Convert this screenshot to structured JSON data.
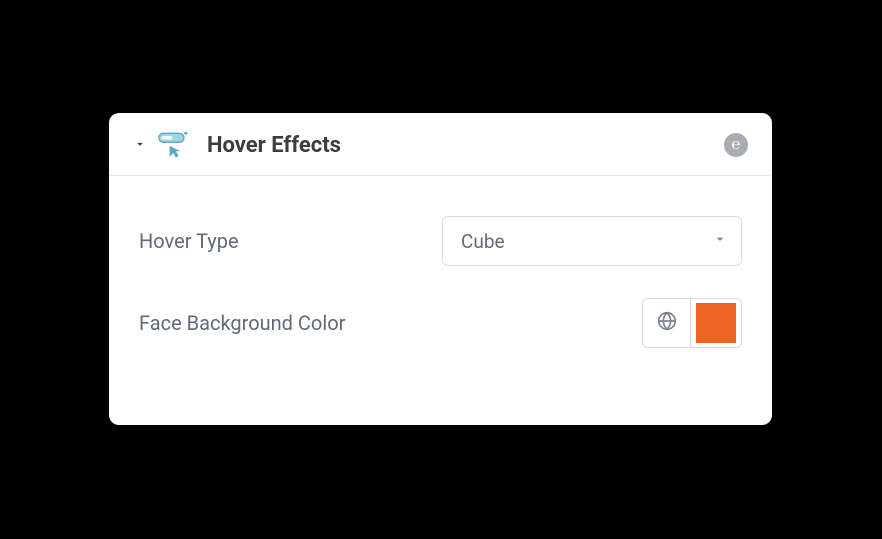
{
  "panel": {
    "title": "Hover Effects",
    "badge_glyph": "℮"
  },
  "controls": {
    "hover_type": {
      "label": "Hover Type",
      "selected": "Cube"
    },
    "face_bg_color": {
      "label": "Face Background Color",
      "value": "#ed6321"
    }
  }
}
